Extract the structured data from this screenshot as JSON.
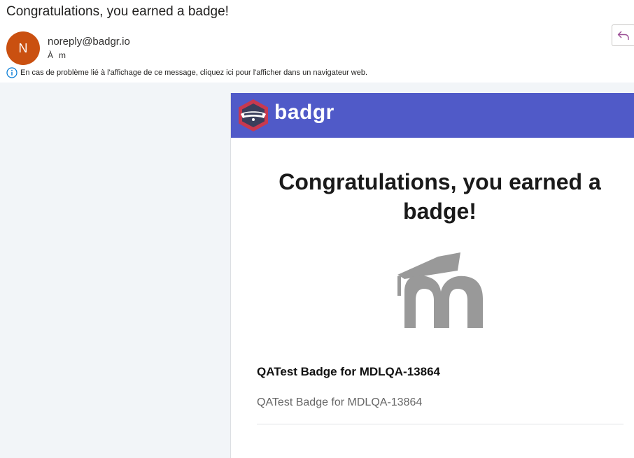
{
  "email": {
    "subject": "Congratulations, you earned a badge!",
    "sender_initial": "N",
    "sender": "noreply@badgr.io",
    "to_label": "À",
    "to_value": "m",
    "info_message": "En cas de problème lié à l'affichage de ce message, cliquez ici pour l'afficher dans un navigateur web."
  },
  "content": {
    "brand": "badgr",
    "headline": "Congratulations, you earned a badge!",
    "badge_name": "QATest Badge for MDLQA-13864",
    "badge_description": "QATest Badge for MDLQA-13864"
  },
  "colors": {
    "avatar": "#ca5010",
    "banner": "#505ac8",
    "badge_gray": "#999999"
  },
  "icons": {
    "reply": "reply-arrow-icon",
    "info": "info-circle-icon",
    "logo": "badgr-badger-logo",
    "badge": "moodle-m-logo"
  }
}
